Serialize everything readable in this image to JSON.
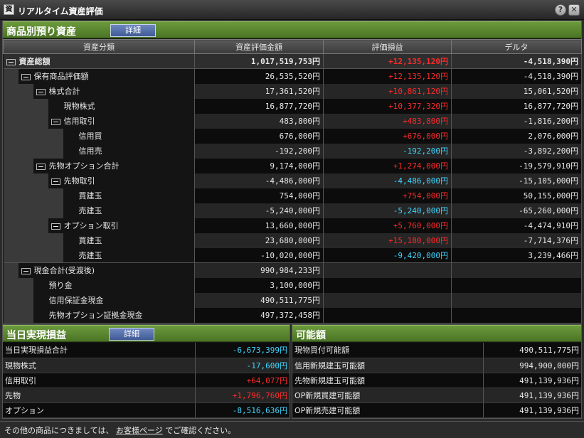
{
  "window": {
    "title": "リアルタイム資産評価",
    "help_icon": "?",
    "close_icon": "✕"
  },
  "section_assets": {
    "title": "商品別預り資産",
    "detail_label": "詳細"
  },
  "columns": [
    "資産分類",
    "資産評価金額",
    "評価損益",
    "デルタ"
  ],
  "rows": [
    {
      "label": "資産総額",
      "level": 0,
      "toggle": true,
      "amount": "1,017,519,753円",
      "pnl": "+12,135,120円",
      "pnl_sign": "pos",
      "delta": "-4,518,390円",
      "total": true
    },
    {
      "label": "保有商品評価額",
      "level": 1,
      "toggle": true,
      "amount": "26,535,520円",
      "pnl": "+12,135,120円",
      "pnl_sign": "pos",
      "delta": "-4,518,390円"
    },
    {
      "label": "株式合計",
      "level": 2,
      "toggle": true,
      "amount": "17,361,520円",
      "pnl": "+10,861,120円",
      "pnl_sign": "pos",
      "delta": "15,061,520円"
    },
    {
      "label": "現物株式",
      "level": 3,
      "toggle": false,
      "amount": "16,877,720円",
      "pnl": "+10,377,320円",
      "pnl_sign": "pos",
      "delta": "16,877,720円"
    },
    {
      "label": "信用取引",
      "level": 3,
      "toggle": true,
      "amount": "483,800円",
      "pnl": "+483,800円",
      "pnl_sign": "pos",
      "delta": "-1,816,200円"
    },
    {
      "label": "信用買",
      "level": 4,
      "toggle": false,
      "amount": "676,000円",
      "pnl": "+676,000円",
      "pnl_sign": "pos",
      "delta": "2,076,000円"
    },
    {
      "label": "信用売",
      "level": 4,
      "toggle": false,
      "amount": "-192,200円",
      "pnl": "-192,200円",
      "pnl_sign": "neg",
      "delta": "-3,892,200円"
    },
    {
      "label": "先物オプション合計",
      "level": 2,
      "toggle": true,
      "amount": "9,174,000円",
      "pnl": "+1,274,000円",
      "pnl_sign": "pos",
      "delta": "-19,579,910円"
    },
    {
      "label": "先物取引",
      "level": 3,
      "toggle": true,
      "amount": "-4,486,000円",
      "pnl": "-4,486,000円",
      "pnl_sign": "neg",
      "delta": "-15,105,000円"
    },
    {
      "label": "買建玉",
      "level": 4,
      "toggle": false,
      "amount": "754,000円",
      "pnl": "+754,000円",
      "pnl_sign": "pos",
      "delta": "50,155,000円"
    },
    {
      "label": "売建玉",
      "level": 4,
      "toggle": false,
      "amount": "-5,240,000円",
      "pnl": "-5,240,000円",
      "pnl_sign": "neg",
      "delta": "-65,260,000円"
    },
    {
      "label": "オプション取引",
      "level": 3,
      "toggle": true,
      "amount": "13,660,000円",
      "pnl": "+5,760,000円",
      "pnl_sign": "pos",
      "delta": "-4,474,910円"
    },
    {
      "label": "買建玉",
      "level": 4,
      "toggle": false,
      "amount": "23,680,000円",
      "pnl": "+15,180,000円",
      "pnl_sign": "pos",
      "delta": "-7,714,376円"
    },
    {
      "label": "売建玉",
      "level": 4,
      "toggle": false,
      "amount": "-10,020,000円",
      "pnl": "-9,420,000円",
      "pnl_sign": "neg",
      "delta": "3,239,466円"
    },
    {
      "label": "現金合計(受渡後)",
      "level": 1,
      "toggle": true,
      "amount": "990,984,233円",
      "pnl": "",
      "pnl_sign": "",
      "delta": "",
      "sep": true
    },
    {
      "label": "預り金",
      "level": 2,
      "toggle": false,
      "amount": "3,100,000円",
      "pnl": "",
      "pnl_sign": "",
      "delta": ""
    },
    {
      "label": "信用保証金現金",
      "level": 2,
      "toggle": false,
      "amount": "490,511,775円",
      "pnl": "",
      "pnl_sign": "",
      "delta": ""
    },
    {
      "label": "先物オプション証拠金現金",
      "level": 2,
      "toggle": false,
      "amount": "497,372,458円",
      "pnl": "",
      "pnl_sign": "",
      "delta": ""
    }
  ],
  "section_realized": {
    "title": "当日実現損益",
    "detail_label": "詳細",
    "rows": [
      {
        "label": "当日実現損益合計",
        "value": "-6,673,399円",
        "sign": "neg"
      },
      {
        "label": "現物株式",
        "value": "-17,600円",
        "sign": "neg"
      },
      {
        "label": "信用取引",
        "value": "+64,077円",
        "sign": "pos"
      },
      {
        "label": "先物",
        "value": "+1,796,760円",
        "sign": "pos"
      },
      {
        "label": "オプション",
        "value": "-8,516,636円",
        "sign": "neg"
      }
    ]
  },
  "section_available": {
    "title": "可能額",
    "rows": [
      {
        "label": "現物買付可能額",
        "value": "490,511,775円"
      },
      {
        "label": "信用新規建玉可能額",
        "value": "994,900,000円"
      },
      {
        "label": "先物新規建玉可能額",
        "value": "491,139,936円"
      },
      {
        "label": "OP新規買建可能額",
        "value": "491,139,936円"
      },
      {
        "label": "OP新規売建可能額",
        "value": "491,139,936円"
      }
    ]
  },
  "footer": {
    "prefix": "その他の商品につきましては、",
    "link": "お客様ページ",
    "suffix": "でご確認ください。"
  },
  "colors": {
    "positive": "#ff2a2a",
    "negative": "#3fd6ff",
    "section_header": "#5b8a2f",
    "button": "#4a66a3"
  }
}
